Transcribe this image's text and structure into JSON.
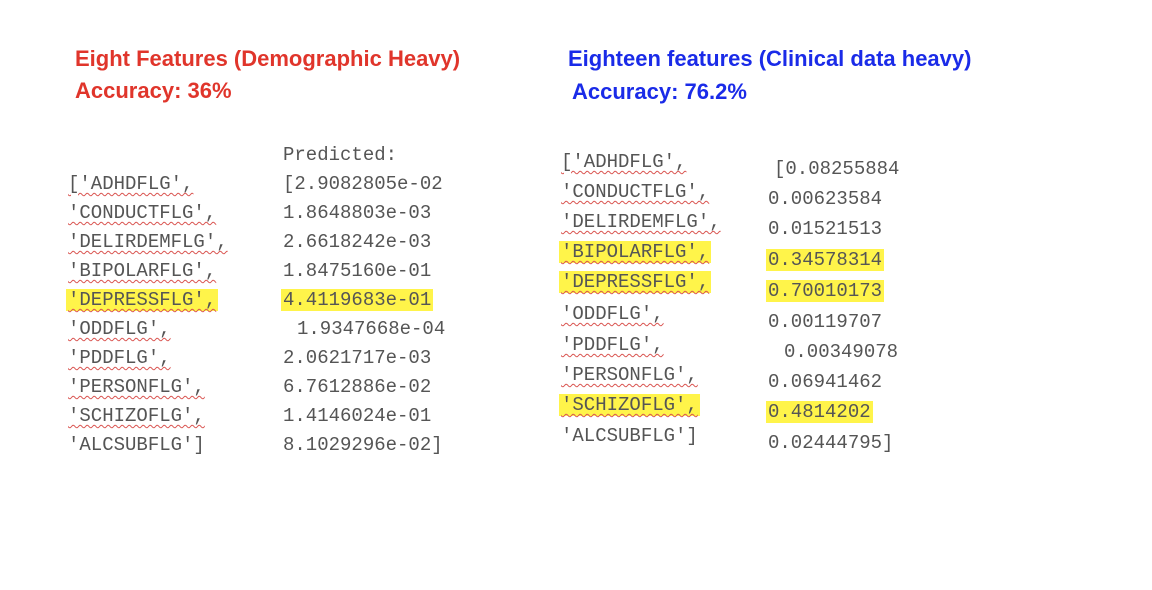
{
  "left": {
    "title": "Eight Features (Demographic Heavy)",
    "accuracy": "Accuracy: 36%",
    "header": "Predicted:",
    "rows": [
      {
        "name": "['ADHDFLG',",
        "value": "[2.9082805e-02"
      },
      {
        "name": "'CONDUCTFLG',",
        "value": "1.8648803e-03"
      },
      {
        "name": "'DELIRDEMFLG',",
        "value": "2.6618242e-03"
      },
      {
        "name": "'BIPOLARFLG',",
        "value": "1.8475160e-01"
      },
      {
        "name": "'DEPRESSFLG',",
        "value": "4.4119683e-01"
      },
      {
        "name": "'ODDFLG',",
        "value": "1.9347668e-04"
      },
      {
        "name": "'PDDFLG',",
        "value": "2.0621717e-03"
      },
      {
        "name": "'PERSONFLG',",
        "value": "6.7612886e-02"
      },
      {
        "name": "'SCHIZOFLG',",
        "value": "1.4146024e-01"
      },
      {
        "name": "'ALCSUBFLG']",
        "value": "8.1029296e-02]"
      }
    ]
  },
  "right": {
    "title": "Eighteen features (Clinical data heavy)",
    "accuracy": "Accuracy: 76.2%",
    "rows": [
      {
        "name": "['ADHDFLG',",
        "value": "[0.08255884"
      },
      {
        "name": "'CONDUCTFLG',",
        "value": "0.00623584"
      },
      {
        "name": "'DELIRDEMFLG',",
        "value": "0.01521513"
      },
      {
        "name": "'BIPOLARFLG',",
        "value": "0.34578314"
      },
      {
        "name": "'DEPRESSFLG',",
        "value": "0.70010173"
      },
      {
        "name": "'ODDFLG',",
        "value": "0.00119707"
      },
      {
        "name": "'PDDFLG',",
        "value": "0.00349078"
      },
      {
        "name": "'PERSONFLG',",
        "value": "0.06941462"
      },
      {
        "name": "'SCHIZOFLG',",
        "value": "0.4814202"
      },
      {
        "name": "'ALCSUBFLG']",
        "value": "0.02444795]"
      }
    ]
  },
  "highlight_color": "#fff44a",
  "left_title_color": "#e0352b",
  "right_title_color": "#1a2be8"
}
